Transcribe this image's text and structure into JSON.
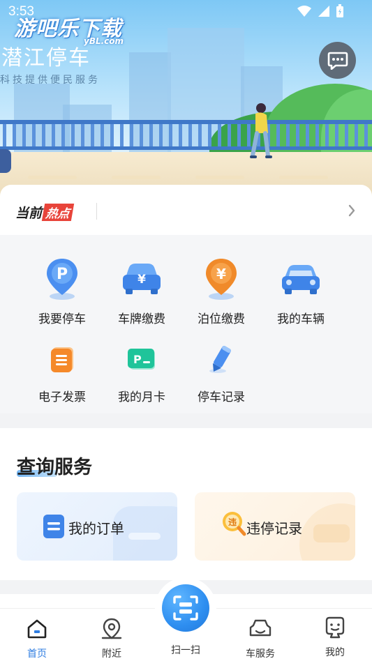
{
  "status_bar": {
    "time": "3:53"
  },
  "watermark": {
    "text": "游吧乐下载",
    "sub": "yBL.com"
  },
  "header": {
    "title": "潜江停车",
    "subtitle": "科技提供便民服务"
  },
  "hot": {
    "label_a": "当前",
    "label_b": "热点"
  },
  "services": [
    {
      "label": "我要停车",
      "icon": "parking-pin-icon"
    },
    {
      "label": "车牌缴费",
      "icon": "plate-payment-icon"
    },
    {
      "label": "泊位缴费",
      "icon": "berth-payment-icon"
    },
    {
      "label": "我的车辆",
      "icon": "car-icon"
    },
    {
      "label": "电子发票",
      "icon": "invoice-icon"
    },
    {
      "label": "我的月卡",
      "icon": "monthly-card-icon"
    },
    {
      "label": "停车记录",
      "icon": "parking-record-icon"
    }
  ],
  "query": {
    "title": "查询服务",
    "orders": {
      "label": "我的订单",
      "badge": ""
    },
    "violations": {
      "label": "违停记录",
      "badge": "违"
    }
  },
  "tabs": [
    {
      "label": "首页",
      "icon": "home-icon",
      "active": true
    },
    {
      "label": "附近",
      "icon": "location-icon",
      "active": false
    },
    {
      "label": "扫一扫",
      "icon": "scan-icon",
      "active": false
    },
    {
      "label": "车服务",
      "icon": "car-service-icon",
      "active": false
    },
    {
      "label": "我的",
      "icon": "profile-icon",
      "active": false
    }
  ],
  "colors": {
    "accent": "#2f7de1",
    "hot_badge": "#e8443a",
    "orange": "#f08a2a"
  }
}
